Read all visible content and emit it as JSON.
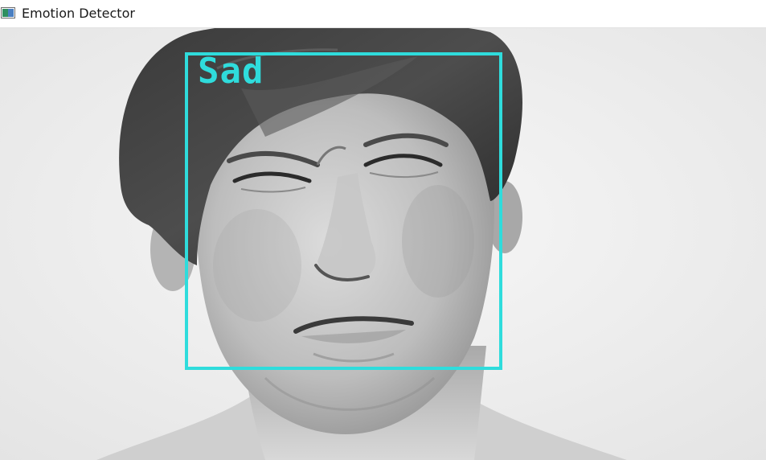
{
  "window": {
    "title": "Emotion Detector",
    "icon": "app-window-icon"
  },
  "detection": {
    "label": "Sad",
    "box_color": "#2fdcdc"
  }
}
